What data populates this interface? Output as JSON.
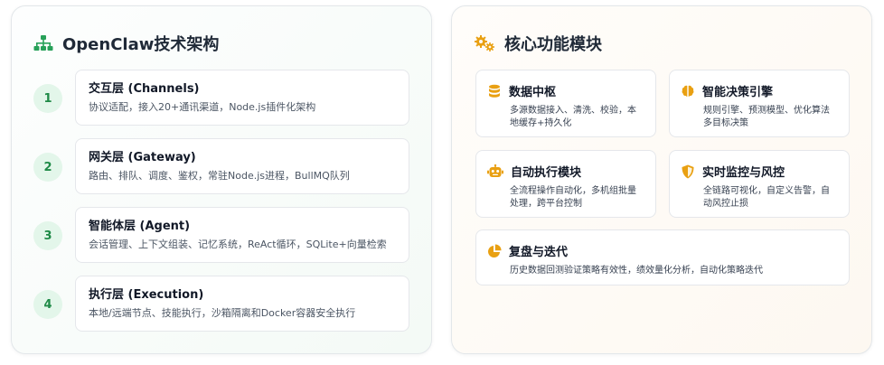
{
  "left_panel": {
    "title": "OpenClaw技术架构",
    "icon": "sitemap-icon",
    "accent": "#27a159",
    "layers": [
      {
        "num": "1",
        "name": "交互层 (Channels)",
        "desc": "协议适配，接入20+通讯渠道，Node.js插件化架构"
      },
      {
        "num": "2",
        "name": "网关层 (Gateway)",
        "desc": "路由、排队、调度、鉴权，常驻Node.js进程，BullMQ队列"
      },
      {
        "num": "3",
        "name": "智能体层 (Agent)",
        "desc": "会话管理、上下文组装、记忆系统，ReAct循环，SQLite+向量检索"
      },
      {
        "num": "4",
        "name": "执行层 (Execution)",
        "desc": "本地/远端节点、技能执行，沙箱隔离和Docker容器安全执行"
      }
    ]
  },
  "right_panel": {
    "title": "核心功能模块",
    "icon": "gears-icon",
    "accent": "#e9a012",
    "modules": [
      {
        "title": "数据中枢",
        "icon": "database-icon",
        "desc": "多源数据接入、清洗、校验，本地缓存+持久化"
      },
      {
        "title": "智能决策引擎",
        "icon": "brain-icon",
        "desc": "规则引擎、预测模型、优化算法多目标决策"
      },
      {
        "title": "自动执行模块",
        "icon": "robot-icon",
        "desc": "全流程操作自动化，多机组批量处理，跨平台控制"
      },
      {
        "title": "实时监控与风控",
        "icon": "shield-icon",
        "desc": "全链路可视化，自定义告警，自动风控止损"
      },
      {
        "title": "复盘与迭代",
        "icon": "pie-chart-icon",
        "desc": "历史数据回测验证策略有效性，绩效量化分析，自动化策略迭代"
      }
    ]
  }
}
